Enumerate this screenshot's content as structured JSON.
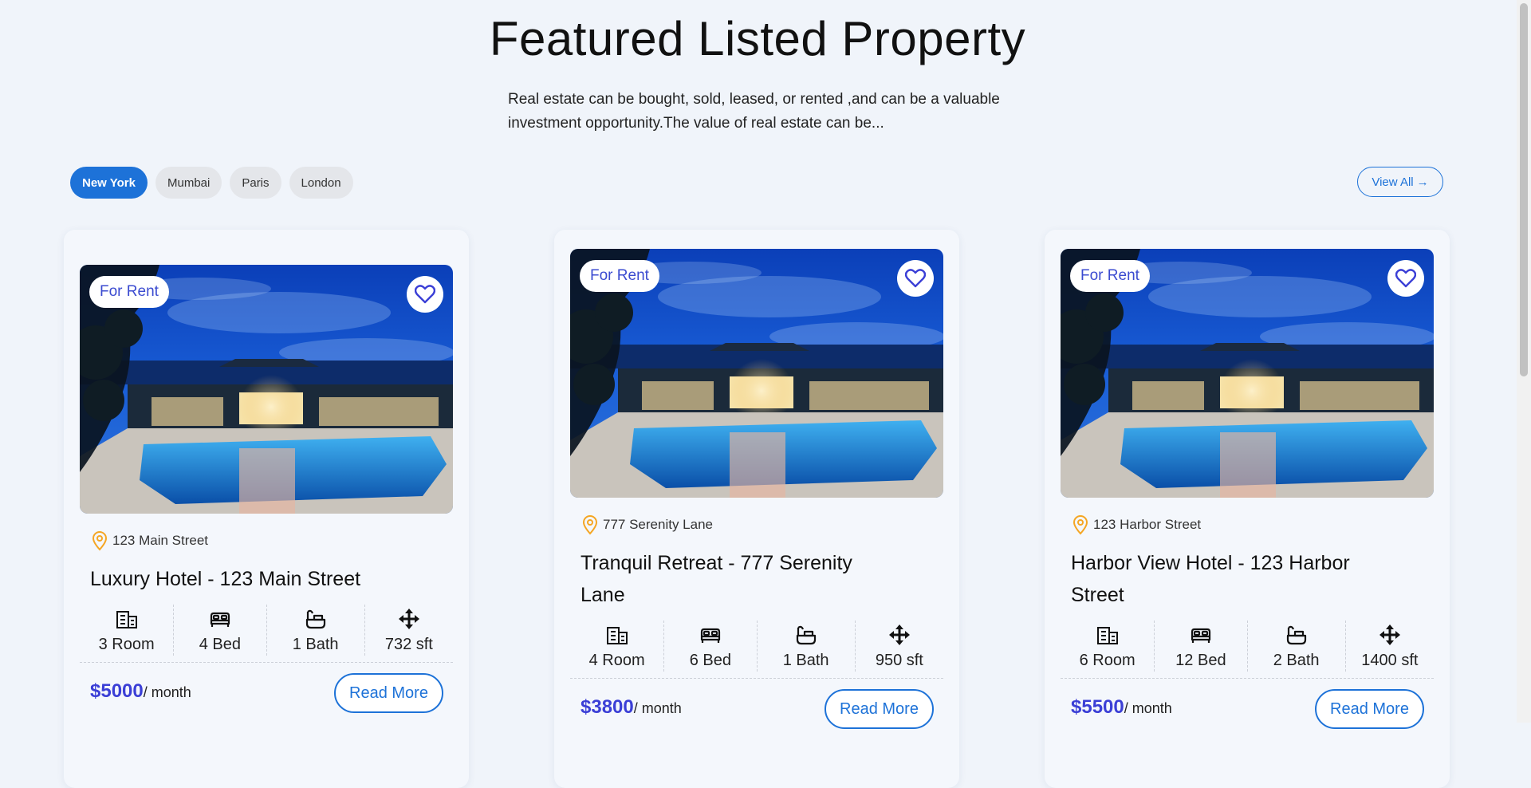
{
  "header": {
    "title": "Featured Listed Property",
    "subtitle": "Real estate can be bought, sold, leased, or rented ,and can be a valuable investment opportunity.The value of real estate can be..."
  },
  "tabs": [
    "New York",
    "Mumbai",
    "Paris",
    "London"
  ],
  "active_tab": "New York",
  "view_all": {
    "label": "View All",
    "arrow": "→"
  },
  "colors": {
    "accent": "#1d72d8",
    "price": "#3b3fd6",
    "pin": "#f5a623"
  },
  "cards": [
    {
      "badge": "For Rent",
      "address": "123 Main Street",
      "title": "Luxury Hotel - 123 Main Street",
      "rooms": "3 Room",
      "beds": "4 Bed",
      "baths": "1 Bath",
      "area": "732 sft",
      "price": "$5000",
      "period": "/ month",
      "read_more": "Read More"
    },
    {
      "badge": "For Rent",
      "address": "777 Serenity Lane",
      "title": "Tranquil Retreat - 777 Serenity Lane",
      "rooms": "4 Room",
      "beds": "6 Bed",
      "baths": "1 Bath",
      "area": "950 sft",
      "price": "$3800",
      "period": "/ month",
      "read_more": "Read More"
    },
    {
      "badge": "For Rent",
      "address": "123 Harbor Street",
      "title": "Harbor View Hotel - 123 Harbor Street",
      "rooms": "6 Room",
      "beds": "12 Bed",
      "baths": "2 Bath",
      "area": "1400 sft",
      "price": "$5500",
      "period": "/ month",
      "read_more": "Read More"
    }
  ]
}
